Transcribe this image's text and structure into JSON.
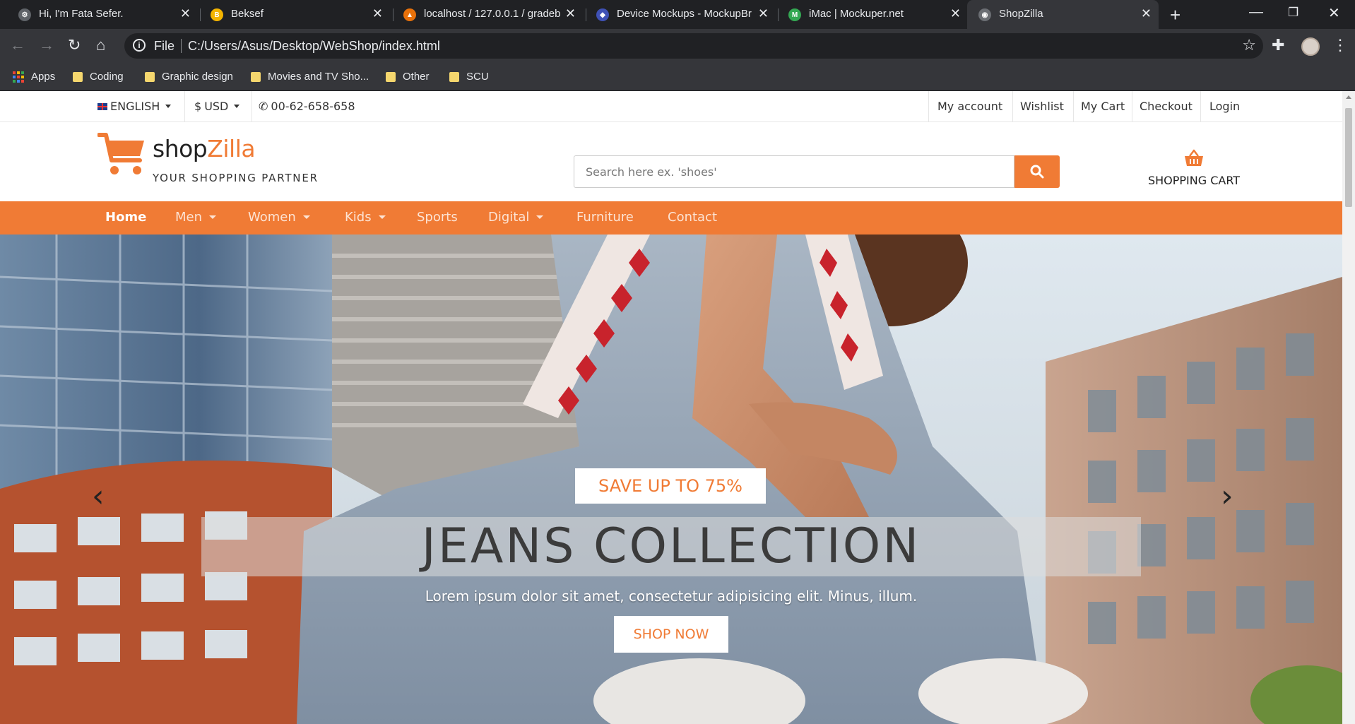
{
  "browser": {
    "tabs": [
      {
        "title": "Hi, I'm Fata Sefer.",
        "favicon_color": "#9aa0a6",
        "favicon_glyph": "⚙"
      },
      {
        "title": "Beksef",
        "favicon_color": "#f4b400",
        "favicon_glyph": "B"
      },
      {
        "title": "localhost / 127.0.0.1 / gradeb",
        "favicon_color": "#e8710a",
        "favicon_glyph": "▲"
      },
      {
        "title": "Device Mockups - MockupBr",
        "favicon_color": "#3f51b5",
        "favicon_glyph": "◆"
      },
      {
        "title": "iMac | Mockuper.net",
        "favicon_color": "#34a853",
        "favicon_glyph": "M"
      },
      {
        "title": "ShopZilla",
        "favicon_color": "#9aa0a6",
        "favicon_glyph": "◉"
      }
    ],
    "address": {
      "scheme": "File",
      "url": "C:/Users/Asus/Desktop/WebShop/index.html"
    },
    "bookmarks": [
      "Apps",
      "Coding",
      "Graphic design",
      "Movies and TV Sho...",
      "Other",
      "SCU"
    ]
  },
  "topbar": {
    "language": "ENGLISH",
    "currency": "USD",
    "currency_symbol": "$",
    "phone": "00-62-658-658",
    "links": [
      "My account",
      "Wishlist",
      "My Cart",
      "Checkout",
      "Login"
    ]
  },
  "header": {
    "brand_main": "shop",
    "brand_accent": "Zilla",
    "tagline": "YOUR SHOPPING PARTNER",
    "search_placeholder": "Search here ex. 'shoes'",
    "cart_label": "SHOPPING CART"
  },
  "nav": {
    "items": [
      "Home",
      "Men",
      "Women",
      "Kids",
      "Sports",
      "Digital",
      "Furniture",
      "Contact"
    ]
  },
  "hero": {
    "badge": "SAVE UP TO 75%",
    "title": "JEANS COLLECTION",
    "subtitle": "Lorem ipsum dolor sit amet, consectetur adipisicing elit. Minus, illum.",
    "cta": "SHOP NOW"
  },
  "colors": {
    "accent": "#f07b35",
    "chrome_dark": "#202124",
    "chrome_mid": "#35363a"
  }
}
